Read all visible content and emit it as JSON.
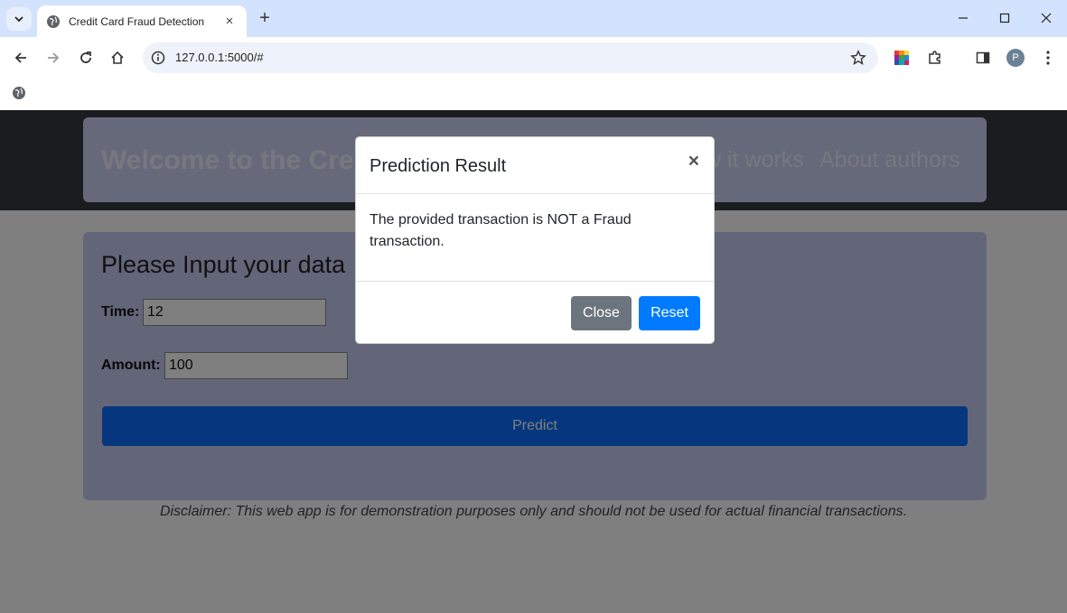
{
  "browser": {
    "tab_title": "Credit Card Fraud Detection",
    "tab_close": "×",
    "new_tab": "+",
    "url": "127.0.0.1:5000/#",
    "profile_initial": "P"
  },
  "header": {
    "welcome": "Welcome to the Cre",
    "nav_how": "w it works",
    "nav_about": "About authors"
  },
  "form": {
    "title": "Please Input your data",
    "time_label": "Time:",
    "time_value": "12",
    "amount_label": "Amount:",
    "amount_value": "100",
    "predict_label": "Predict"
  },
  "disclaimer": "Disclaimer: This web app is for demonstration purposes only and should not be used for actual financial transactions.",
  "modal": {
    "title": "Prediction Result",
    "close_x": "×",
    "message": "The provided transaction is NOT a Fraud transaction.",
    "close_label": "Close",
    "reset_label": "Reset"
  },
  "colors": {
    "tabbar": "#d3e3fd",
    "header": "#343a40",
    "card": "#cdd3f4",
    "primary": "#007bff",
    "secondary": "#6c757d"
  }
}
